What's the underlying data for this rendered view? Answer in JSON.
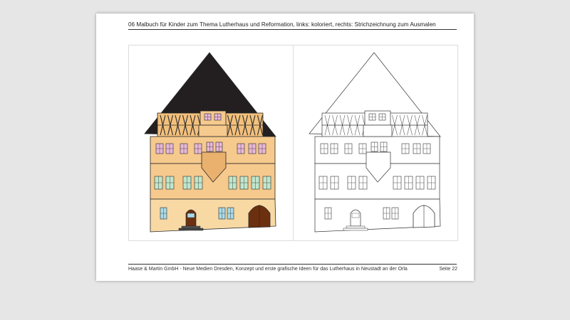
{
  "document": {
    "header": "06 Malbuch für Kinder zum Thema Lutherhaus und Reformation, links: koloriert, rechts: Strichzeichnung zum Ausmalen",
    "footer": "Haase & Martin GmbH - Neue Medien Dresden, Konzept und erste grafische Ideen für das Lutherhaus in Neustadt an der Orla",
    "page_label": "Seite 22"
  },
  "illustrations": {
    "colored": {
      "roof": "#231f20",
      "upper_wall": "#f6c98d",
      "lower_wall": "#f8d9a4",
      "timber": "#2a2a2a",
      "door": "#6b3010",
      "window_upper": "#e9b8d8",
      "window_lower": "#bfe6cc",
      "window_ground": "#a8dbe8"
    },
    "line_art": {
      "stroke": "#333333",
      "fill": "#ffffff"
    }
  }
}
